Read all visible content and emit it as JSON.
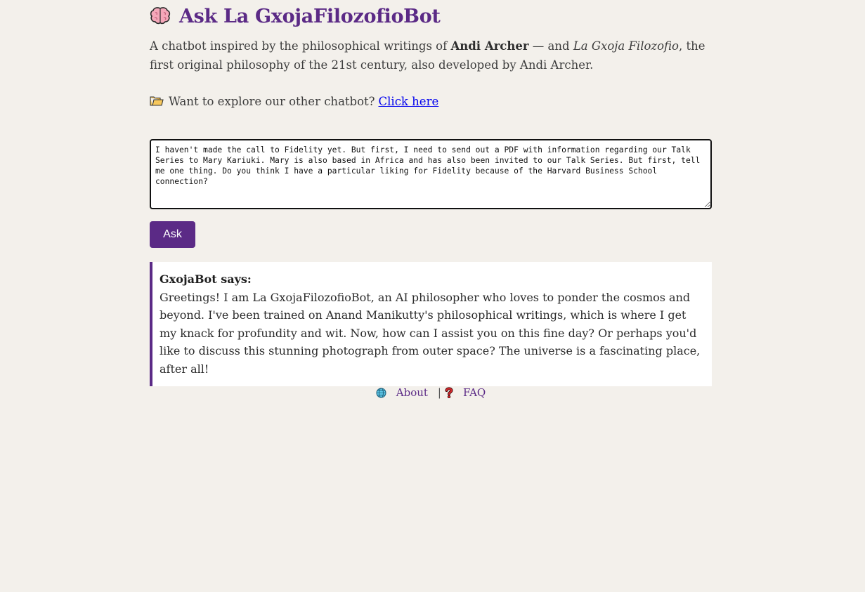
{
  "header": {
    "title": "Ask La GxojaFilozofioBot",
    "icon": "brain-icon"
  },
  "intro": {
    "text_before": "A chatbot inspired by the philosophical writings of ",
    "author": "Andi Archer",
    "text_middle": " — and ",
    "work": "La Gxoja Filozofio",
    "text_after": ", the first original philosophy of the 21st century, also developed by Andi Archer."
  },
  "explore": {
    "icon": "folder-icon",
    "text": "Want to explore our other chatbot?",
    "link_label": "Click here"
  },
  "question": {
    "value": "I haven't made the call to Fidelity yet. But first, I need to send out a PDF with information regarding our Talk Series to Mary Kariuki. Mary is also based in Africa and has also been invited to our Talk Series. But first, tell me one thing. Do you think I have a particular liking for Fidelity because of the Harvard Business School connection?"
  },
  "ask_button": {
    "label": "Ask"
  },
  "answer": {
    "speaker": "GxojaBot says:",
    "text": "Greetings! I am La GxojaFilozofioBot, an AI philosopher who loves to ponder the cosmos and beyond. I've been trained on Anand Manikutty's philosophical writings, which is where I get my knack for profundity and wit. Now, how can I assist you on this fine day? Or perhaps you'd like to discuss this stunning photograph from outer space? The universe is a fascinating place, after all!"
  },
  "footer": {
    "about_label": "About",
    "separator": "|",
    "faq_label": "FAQ"
  },
  "colors": {
    "accent": "#5b2a86",
    "background": "#f3f0eb",
    "link": "#0000ee"
  }
}
